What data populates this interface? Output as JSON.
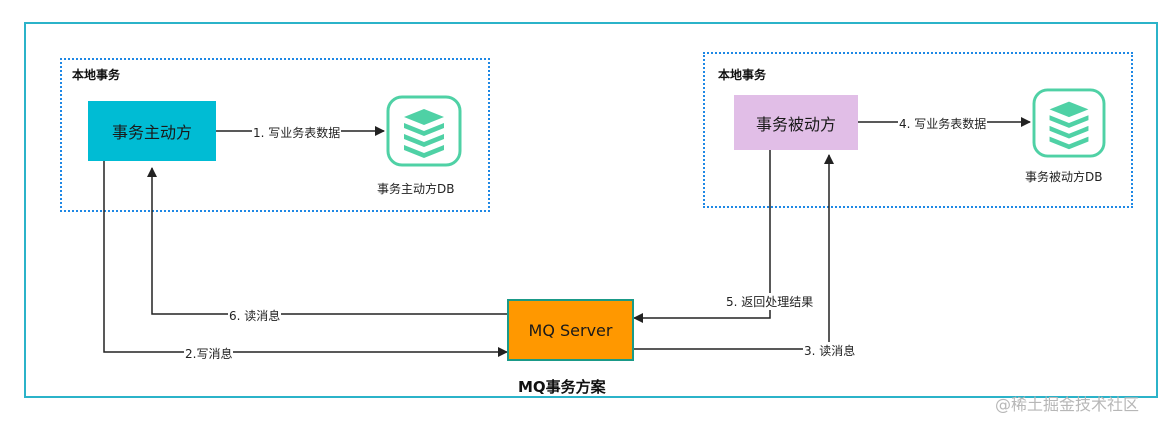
{
  "diagram": {
    "title": "MQ事务方案",
    "watermark": "@稀土掘金技术社区",
    "groups": {
      "left": "本地事务",
      "right": "本地事务"
    },
    "nodes": {
      "initiator": "事务主动方",
      "participant": "事务被动方",
      "mq": "MQ Server",
      "initiator_db": "事务主动方DB",
      "participant_db": "事务被动方DB"
    },
    "edges": {
      "e1": "1. 写业务表数据",
      "e2": "2.写消息",
      "e3": "3. 读消息",
      "e4": "4. 写业务表数据",
      "e5": "5. 返回处理结果",
      "e6": "6. 读消息"
    },
    "colors": {
      "frame": "#2bb3c9",
      "group_border": "#1e88e5",
      "initiator_fill": "#00bcd4",
      "participant_fill": "#e1bee7",
      "mq_fill": "#ff9800",
      "db_icon": "#4fd1a5"
    },
    "icons": {
      "initiator_db": "database-stack-icon",
      "participant_db": "database-stack-icon"
    }
  }
}
